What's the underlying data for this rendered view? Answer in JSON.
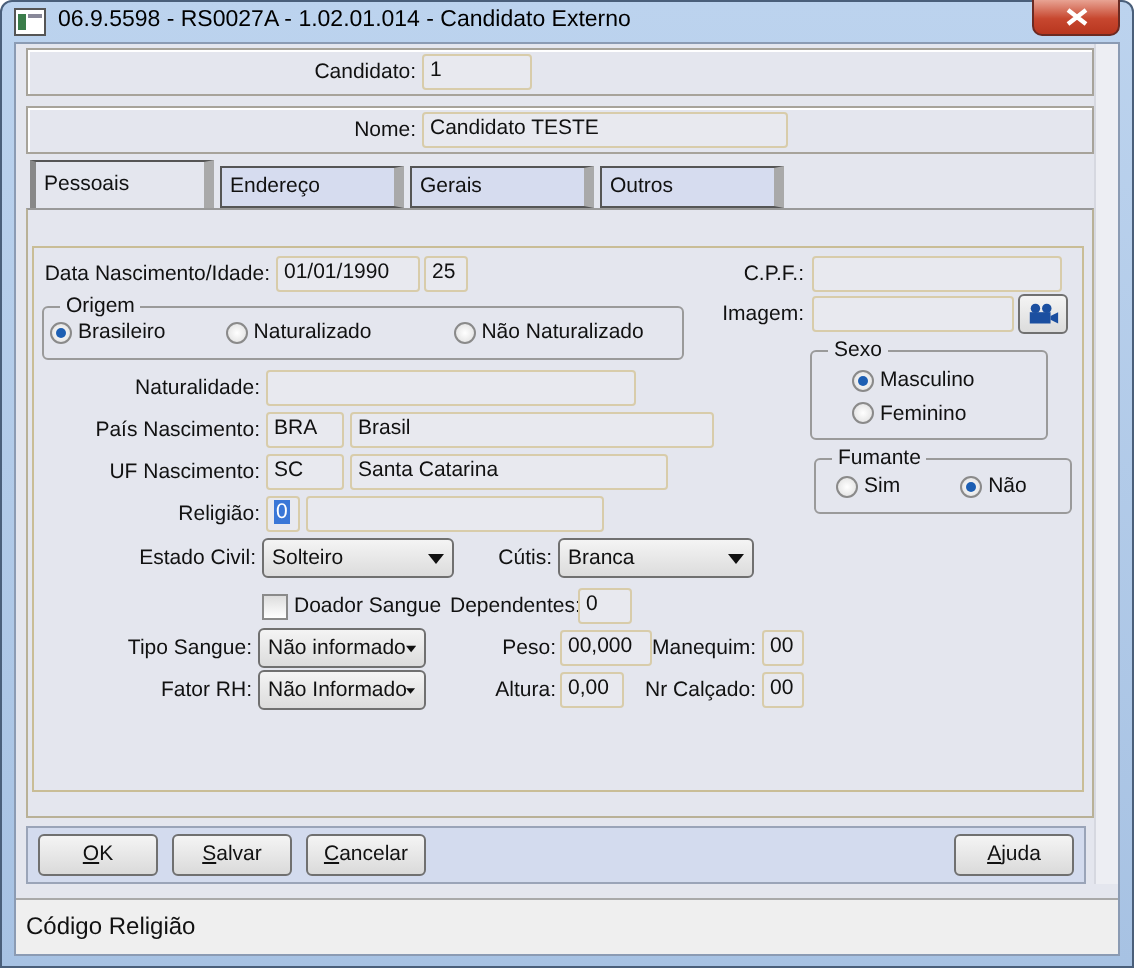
{
  "window": {
    "title": "06.9.5598 - RS0027A - 1.02.01.014 - Candidato Externo"
  },
  "header": {
    "candidato_label": "Candidato:",
    "candidato": "1",
    "nome_label": "Nome:",
    "nome": "Candidato TESTE"
  },
  "tabs": [
    {
      "label": "Pessoais",
      "selected": true
    },
    {
      "label": "Endereço",
      "selected": false
    },
    {
      "label": "Gerais",
      "selected": false
    },
    {
      "label": "Outros",
      "selected": false
    }
  ],
  "form": {
    "birth": {
      "label": "Data Nascimento/Idade:",
      "date": "01/01/1990",
      "age": "25"
    },
    "cpf": {
      "label": "C.P.F.:"
    },
    "origem": {
      "legend": "Origem",
      "options": [
        {
          "label": "Brasileiro",
          "selected": true
        },
        {
          "label": "Naturalizado",
          "selected": false
        },
        {
          "label": "Não Naturalizado",
          "selected": false
        }
      ]
    },
    "imagem": {
      "label": "Imagem:"
    },
    "sexo": {
      "legend": "Sexo",
      "options": [
        {
          "label": "Masculino",
          "selected": true
        },
        {
          "label": "Feminino",
          "selected": false
        }
      ]
    },
    "fumante": {
      "legend": "Fumante",
      "options": [
        {
          "label": "Sim",
          "selected": false
        },
        {
          "label": "Não",
          "selected": true
        }
      ]
    },
    "naturalidade": {
      "label": "Naturalidade:"
    },
    "pais": {
      "label": "País Nascimento:",
      "code": "BRA",
      "name": "Brasil"
    },
    "uf": {
      "label": "UF Nascimento:",
      "code": "SC",
      "name": "Santa Catarina"
    },
    "religiao": {
      "label": "Religião:",
      "code": "0",
      "code_highlighted": true
    },
    "estado_civil": {
      "label": "Estado Civil:",
      "value": "Solteiro"
    },
    "cutis": {
      "label": "Cútis:",
      "value": "Branca"
    },
    "doador": {
      "label": "Doador Sangue",
      "checked": false
    },
    "dependentes": {
      "label": "Dependentes:",
      "value": "0"
    },
    "tipo_sangue": {
      "label": "Tipo Sangue:",
      "value": "Não informado"
    },
    "peso": {
      "label": "Peso:",
      "value": "00,000"
    },
    "manequim": {
      "label": "Manequim:",
      "value": "00"
    },
    "fator_rh": {
      "label": "Fator RH:",
      "value": "Não Informado"
    },
    "altura": {
      "label": "Altura:",
      "value": "0,00"
    },
    "nr_calcado": {
      "label": "Nr Calçado:",
      "value": "00"
    }
  },
  "buttons": [
    {
      "label": "OK"
    },
    {
      "label": "Salvar"
    },
    {
      "label": "Cancelar"
    },
    {
      "label": "Ajuda"
    }
  ],
  "status_bar": "Código Religião"
}
